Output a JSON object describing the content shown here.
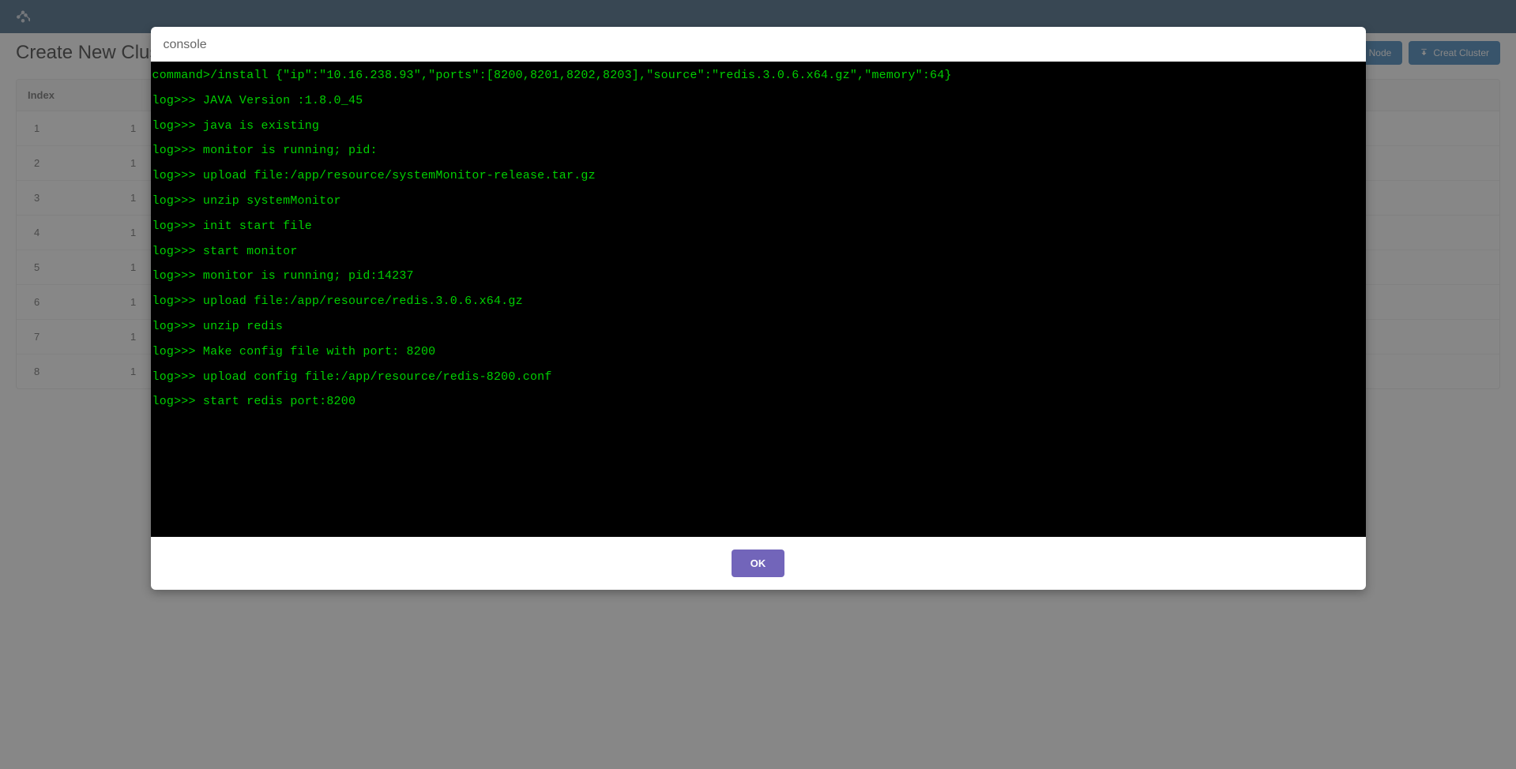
{
  "topbar": {
    "logo_icon": "joomla-icon"
  },
  "page": {
    "title": "Create New Cluster"
  },
  "buttons": {
    "install_node": "install Node",
    "create_cluster": "Creat Cluster"
  },
  "table": {
    "headers": {
      "index": "Index"
    },
    "rows": [
      {
        "index": "1",
        "col2": "1"
      },
      {
        "index": "2",
        "col2": "1"
      },
      {
        "index": "3",
        "col2": "1"
      },
      {
        "index": "4",
        "col2": "1"
      },
      {
        "index": "5",
        "col2": "1"
      },
      {
        "index": "6",
        "col2": "1"
      },
      {
        "index": "7",
        "col2": "1"
      },
      {
        "index": "8",
        "col2": "1"
      }
    ]
  },
  "modal": {
    "title": "console",
    "ok_label": "OK",
    "console_lines": [
      "command>/install {\"ip\":\"10.16.238.93\",\"ports\":[8200,8201,8202,8203],\"source\":\"redis.3.0.6.x64.gz\",\"memory\":64}",
      "log>>> JAVA Version :1.8.0_45",
      "log>>> java is existing",
      "log>>> monitor is running; pid:",
      "log>>> upload file:/app/resource/systemMonitor-release.tar.gz",
      "log>>> unzip systemMonitor",
      "log>>> init start file",
      "log>>> start monitor",
      "log>>> monitor is running; pid:14237",
      "log>>> upload file:/app/resource/redis.3.0.6.x64.gz",
      "log>>> unzip redis",
      "log>>> Make config file with port: 8200",
      "log>>> upload config file:/app/resource/redis-8200.conf",
      "log>>> start redis port:8200"
    ]
  }
}
